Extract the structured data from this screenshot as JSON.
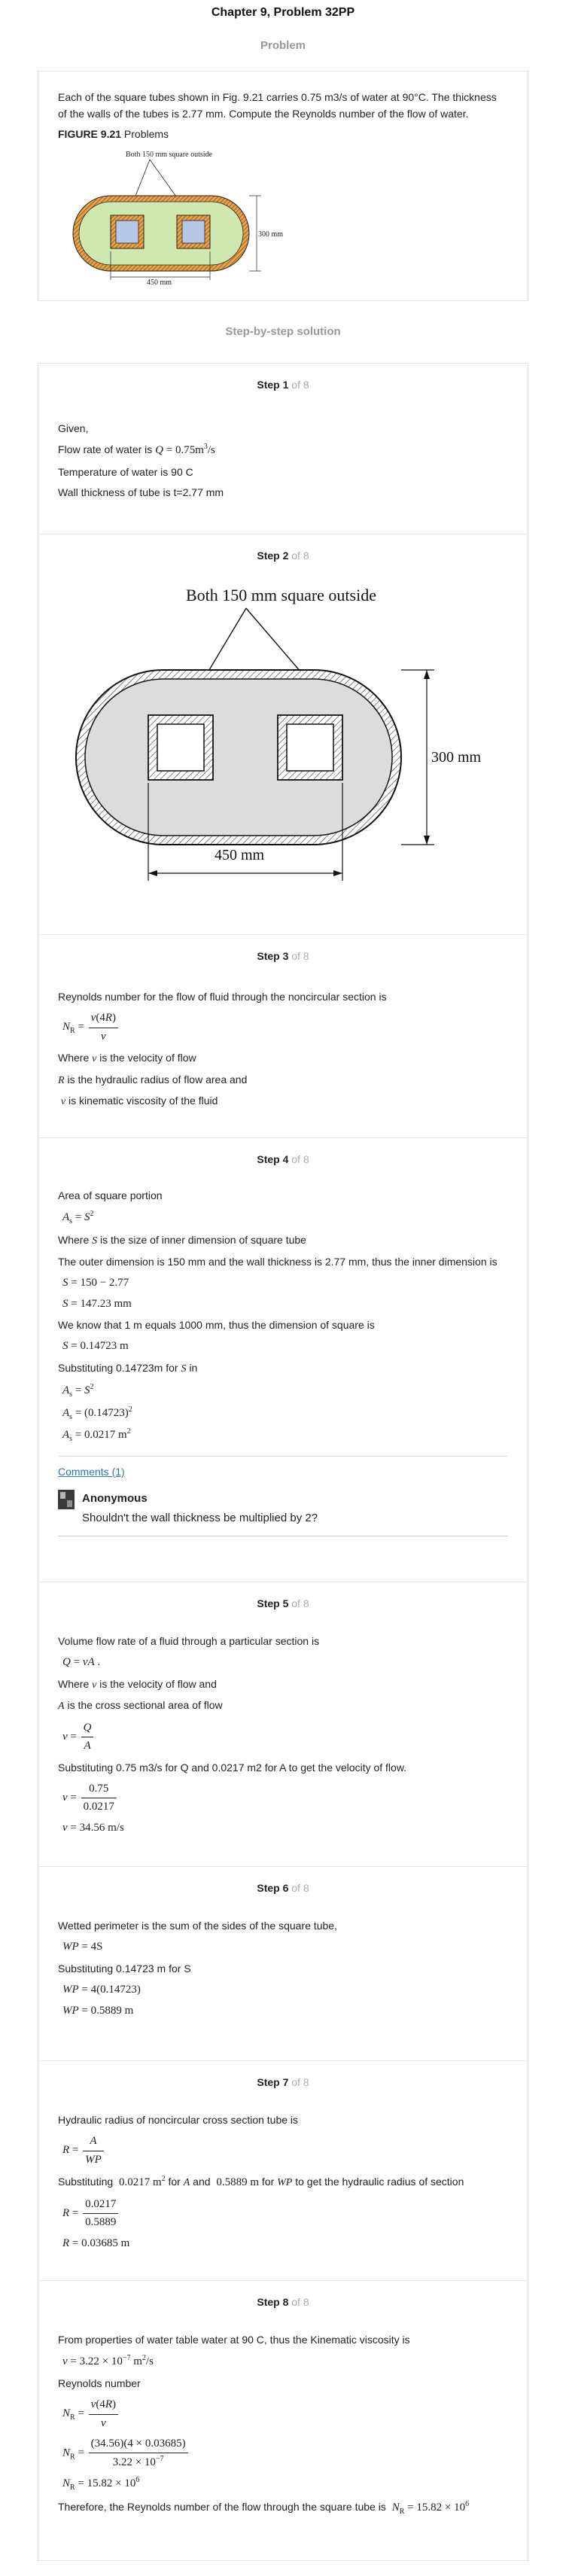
{
  "header": {
    "title": "Chapter 9, Problem 32PP",
    "problem_label": "Problem",
    "solution_label": "Step-by-step solution"
  },
  "problem": {
    "text": "Each of the square tubes shown in Fig. 9.21 carries 0.75 m3/s of water at 90°C. The thickness of the walls of the tubes is 2.77 mm. Compute the Reynolds number of the flow of water.",
    "figure_label": "FIGURE 9.21",
    "figure_caption": "Problems",
    "fig_top": "Both 150 mm square outside",
    "fig_height": "300 mm",
    "fig_width": "450 mm"
  },
  "step_of": "of 8",
  "steps": {
    "s1": {
      "label": "Step 1",
      "given": "Given,",
      "flow_prefix": "Flow rate of water is",
      "temp": "Temperature of water is 90 C",
      "wall": "Wall thickness of tube is t=2.77 mm"
    },
    "s2": {
      "label": "Step 2",
      "fig_top": "Both 150 mm square outside",
      "fig_height": "300 mm",
      "fig_width": "450 mm"
    },
    "s3": {
      "label": "Step 3",
      "intro": "Reynolds number for the flow of fluid through the noncircular section is",
      "where_v": "is the velocity of flow",
      "where_r": "is the hydraulic radius of flow area and",
      "where_nu": "is kinematic viscosity of the fluid"
    },
    "s4": {
      "label": "Step 4",
      "intro": "Area of square portion",
      "where_s": "is the size of inner dimension of square tube",
      "outer": "The outer dimension is 150 mm and the wall thickness is 2.77 mm, thus the inner dimension is",
      "eq1": "150 − 2.77",
      "eq2": "147.23 mm",
      "know": "We know that 1 m equals 1000 mm, thus the dimension of square is",
      "eq3": "0.14723 m",
      "subst": "Substituting 0.14723m for",
      "eq4": "(0.14723)",
      "eq5": "0.0217 m",
      "comments_link": "Comments (1)",
      "comment_author": "Anonymous",
      "comment_text": "Shouldn't the wall thickness be multiplied by 2?"
    },
    "s5": {
      "label": "Step 5",
      "intro": "Volume flow rate of a fluid through a particular section is",
      "where_v": "is the velocity of flow and",
      "where_a": "is the cross sectional area of flow",
      "subst": "Substituting 0.75 m3/s for Q and 0.0217 m2 for A to get the velocity of flow.",
      "num": "0.75",
      "den": "0.0217",
      "result": "34.56 m/s"
    },
    "s6": {
      "label": "Step 6",
      "intro": "Wetted perimeter is the sum of the sides of the square tube,",
      "eq1": "4S",
      "subst": "Substituting 0.14723 m for S",
      "eq2": "4(0.14723)",
      "eq3": "0.5889 m"
    },
    "s7": {
      "label": "Step 7",
      "intro": "Hydraulic radius of noncircular cross section tube is",
      "subst_a": "0.0217 m",
      "subst_mid": "for",
      "subst_b": "0.5889 m",
      "subst_end": "to get the hydraulic radius of section",
      "num": "0.0217",
      "den": "0.5889",
      "result": "0.03685 m"
    },
    "s8": {
      "label": "Step 8",
      "intro": "From properties of water table water at 90 C, thus the Kinematic viscosity is",
      "nu": "3.22 × 10",
      "reynolds": "Reynolds number",
      "num": "(34.56)(4 × 0.03685)",
      "den": "3.22 × 10",
      "result": "15.82 × 10",
      "conclusion": "Therefore, the Reynolds number of the flow through the square tube is"
    }
  }
}
